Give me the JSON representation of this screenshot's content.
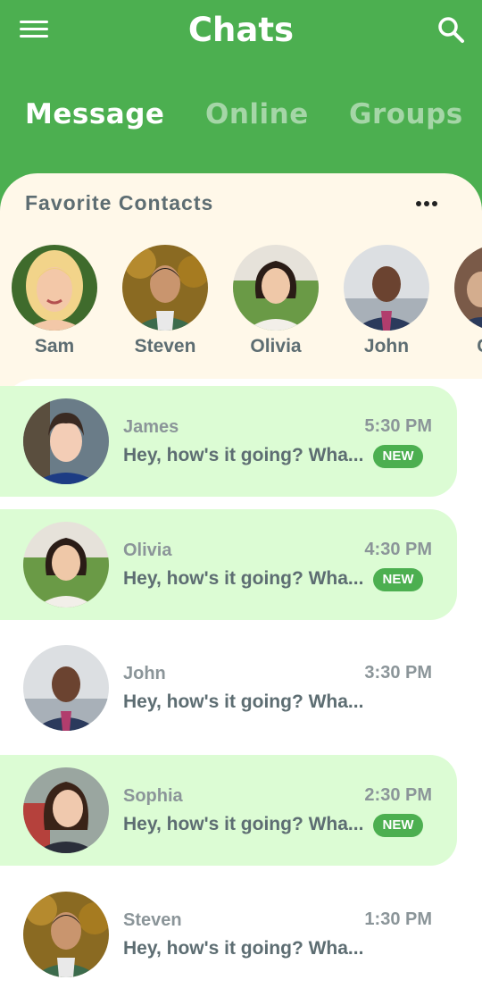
{
  "app": {
    "title": "Chats"
  },
  "tabs": [
    {
      "label": "Message"
    },
    {
      "label": "Online"
    },
    {
      "label": "Groups"
    }
  ],
  "favorites": {
    "title": "Favorite Contacts",
    "contacts": [
      {
        "name": "Sam"
      },
      {
        "name": "Steven"
      },
      {
        "name": "Olivia"
      },
      {
        "name": "John"
      },
      {
        "name": "Ch..."
      }
    ]
  },
  "chats": [
    {
      "name": "James",
      "message": "Hey, how's it going? Wha...",
      "time": "5:30 PM",
      "badge": "NEW"
    },
    {
      "name": "Olivia",
      "message": "Hey, how's it going? Wha...",
      "time": "4:30 PM",
      "badge": "NEW"
    },
    {
      "name": "John",
      "message": "Hey, how's it going? Wha...",
      "time": "3:30 PM",
      "badge": ""
    },
    {
      "name": "Sophia",
      "message": "Hey, how's it going? Wha...",
      "time": "2:30 PM",
      "badge": "NEW"
    },
    {
      "name": "Steven",
      "message": "Hey, how's it going? Wha...",
      "time": "1:30 PM",
      "badge": ""
    }
  ],
  "colors": {
    "primary": "#4caf50",
    "favorites_bg": "#fff8e9",
    "unread_bg": "#dcfcd4",
    "text_dark": "#5d6d72",
    "text_muted": "#8b9599",
    "tab_inactive": "#a5d6a7"
  },
  "icons": {
    "menu": "menu-icon",
    "search": "search-icon",
    "more": "more-horizontal-icon"
  }
}
